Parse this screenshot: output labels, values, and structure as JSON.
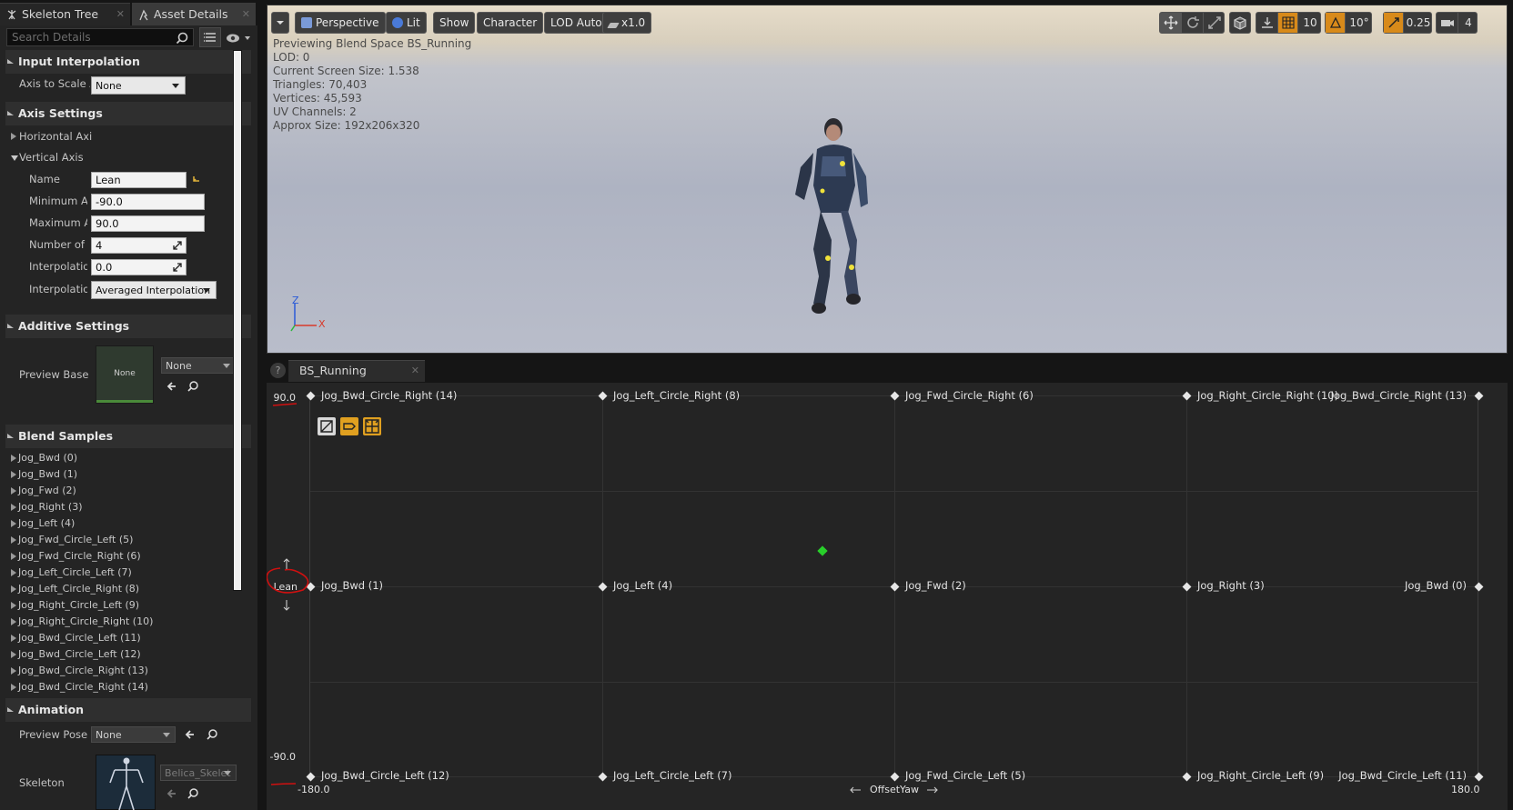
{
  "tabs": [
    {
      "label": "Skeleton Tree"
    },
    {
      "label": "Asset Details"
    }
  ],
  "search": {
    "placeholder": "Search Details"
  },
  "categories": {
    "input_interpolation": "Input Interpolation",
    "axis_settings": "Axis Settings",
    "additive_settings": "Additive Settings",
    "blend_samples": "Blend Samples",
    "animation": "Animation"
  },
  "input_interpolation": {
    "axis_to_scale_label": "Axis to Scale A",
    "axis_to_scale_value": "None"
  },
  "axis_settings": {
    "horizontal_label": "Horizontal Axi",
    "vertical_label": "Vertical Axis",
    "name_label": "Name",
    "name_value": "Lean",
    "min_label": "Minimum Ax",
    "min_value": "-90.0",
    "max_label": "Maximum A:",
    "max_value": "90.0",
    "grid_label": "Number of Gr",
    "grid_value": "4",
    "interp_time_label": "Interpolation",
    "interp_time_value": "0.0",
    "interp_type_label": "Interpolation",
    "interp_type_value": "Averaged Interpolation"
  },
  "additive": {
    "preview_label": "Preview Base F",
    "thumb_text": "None",
    "dropdown": "None"
  },
  "blend_samples": [
    "Jog_Bwd (0)",
    "Jog_Bwd (1)",
    "Jog_Fwd (2)",
    "Jog_Right (3)",
    "Jog_Left (4)",
    "Jog_Fwd_Circle_Left (5)",
    "Jog_Fwd_Circle_Right (6)",
    "Jog_Left_Circle_Left (7)",
    "Jog_Left_Circle_Right (8)",
    "Jog_Right_Circle_Left (9)",
    "Jog_Right_Circle_Right (10)",
    "Jog_Bwd_Circle_Left (11)",
    "Jog_Bwd_Circle_Left (12)",
    "Jog_Bwd_Circle_Right (13)",
    "Jog_Bwd_Circle_Right (14)"
  ],
  "animation": {
    "preview_pose_label": "Preview Pose /",
    "preview_pose_value": "None",
    "skeleton_label": "Skeleton",
    "skeleton_value": "Belica_Skelet"
  },
  "viewport": {
    "perspective": "Perspective",
    "lit": "Lit",
    "show": "Show",
    "character": "Character",
    "lod": "LOD Auto",
    "speed": "x1.0",
    "grid_snap": "10",
    "rot_snap": "10°",
    "scale_snap": "0.25",
    "cam_speed": "4",
    "stats": [
      "Previewing Blend Space BS_Running",
      "LOD: 0",
      "Current Screen Size: 1.538",
      "Triangles: 70,403",
      "Vertices: 45,593",
      "UV Channels: 2",
      "Approx Size: 192x206x320"
    ],
    "axis_z": "Z",
    "axis_x": "X",
    "accent": "#d88a1a"
  },
  "blendspace": {
    "tab_label": "BS_Running",
    "help": "?",
    "y_max": "90.0",
    "y_min": "-90.0",
    "y_name": "Lean",
    "x_min": "-180.0",
    "x_max": "180.0",
    "x_name": "OffsetYaw",
    "top_row": [
      "Jog_Bwd_Circle_Right (14)",
      "Jog_Left_Circle_Right (8)",
      "Jog_Fwd_Circle_Right (6)",
      "Jog_Right_Circle_Right (10)",
      "Jog_Bwd_Circle_Right (13)"
    ],
    "mid_row": [
      "Jog_Bwd (1)",
      "Jog_Left (4)",
      "Jog_Fwd (2)",
      "Jog_Right (3)",
      "Jog_Bwd (0)"
    ],
    "bot_row": [
      "Jog_Bwd_Circle_Left (12)",
      "Jog_Left_Circle_Left (7)",
      "Jog_Fwd_Circle_Left (5)",
      "Jog_Right_Circle_Left (9)",
      "Jog_Bwd_Circle_Left (11)"
    ],
    "preview_color": "#28d02a"
  }
}
